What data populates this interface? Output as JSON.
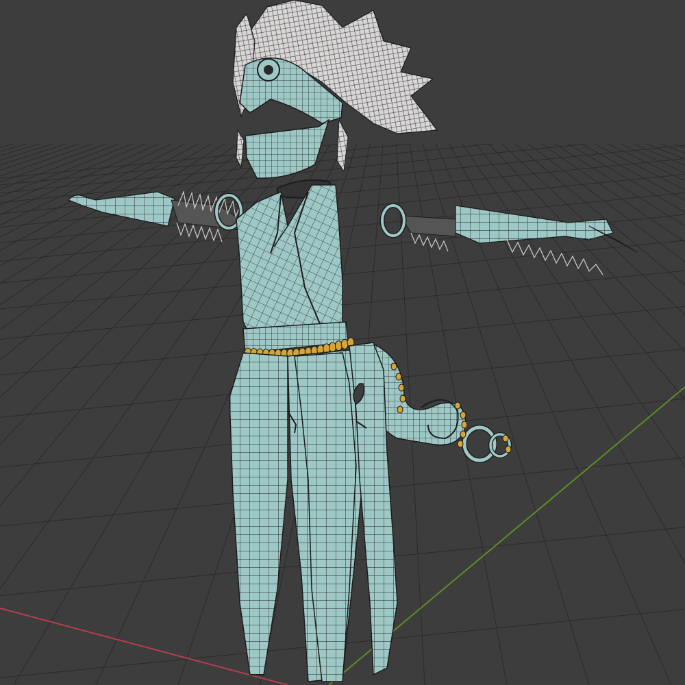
{
  "viewport": {
    "background_color": "#3d3d3d",
    "grid_line_color": "#2a2a2a",
    "x_axis_color": "#b4414b",
    "y_axis_color": "#5f8c25",
    "mesh_fill_color": "#9ec8c6",
    "mesh_fill_dark": "#7fa9a7",
    "wire_color": "#1c1c1c",
    "feather_fill_color": "#d9d6d6",
    "bead_color": "#d4a63a"
  },
  "model": {
    "parts": [
      "headdress-feathers",
      "mask",
      "dress",
      "belt-beads",
      "left-arm-sleeve",
      "right-arm-sleeve",
      "tail-swirl"
    ]
  }
}
